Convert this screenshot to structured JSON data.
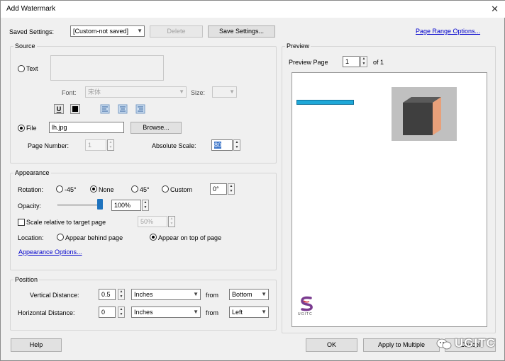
{
  "window": {
    "title": "Add Watermark",
    "close_glyph": "✕"
  },
  "saved_settings": {
    "label": "Saved Settings:",
    "value": "[Custom-not saved]",
    "delete_label": "Delete",
    "save_settings_label": "Save Settings...",
    "page_range_link": "Page Range Options..."
  },
  "source": {
    "title": "Source",
    "text_label": "Text",
    "font_label": "Font:",
    "font_value": "宋体",
    "size_label": "Size:",
    "size_value": "",
    "underline_glyph": "U",
    "file_label": "File",
    "file_value": "lh.jpg",
    "browse_label": "Browse...",
    "page_number_label": "Page Number:",
    "page_number_value": "1",
    "absolute_scale_label": "Absolute Scale:",
    "absolute_scale_value": "80"
  },
  "appearance": {
    "title": "Appearance",
    "rotation_label": "Rotation:",
    "rotation_options": [
      "-45°",
      "None",
      "45°",
      "Custom"
    ],
    "rotation_selected": "None",
    "custom_rotation_value": "0°",
    "opacity_label": "Opacity:",
    "opacity_value": "100%",
    "opacity_level": 1.0,
    "scale_relative_label": "Scale relative to target page",
    "scale_relative_value": "50%",
    "location_label": "Location:",
    "behind_label": "Appear behind page",
    "on_top_label": "Appear on top of page",
    "location_selected": "Appear on top of page",
    "appearance_options_link": "Appearance Options..."
  },
  "position": {
    "title": "Position",
    "vertical_label": "Vertical Distance:",
    "vertical_value": "0.5",
    "vertical_units": "Inches",
    "from_label_1": "from",
    "vertical_from": "Bottom",
    "horizontal_label": "Horizontal Distance:",
    "horizontal_value": "0",
    "horizontal_units": "Inches",
    "from_label_2": "from",
    "horizontal_from": "Left"
  },
  "preview": {
    "title": "Preview",
    "preview_page_label": "Preview Page",
    "page_value": "1",
    "of_label": "of 1",
    "logo_text": "UGITC"
  },
  "footer": {
    "help_label": "Help",
    "ok_label": "OK",
    "apply_multiple_label": "Apply to Multiple",
    "cancel_label": "Cancel",
    "watermark_text": "UGITC"
  },
  "colors": {
    "link": "#0000cc",
    "accent": "#1e73be",
    "bar": "#1fa8d8"
  }
}
